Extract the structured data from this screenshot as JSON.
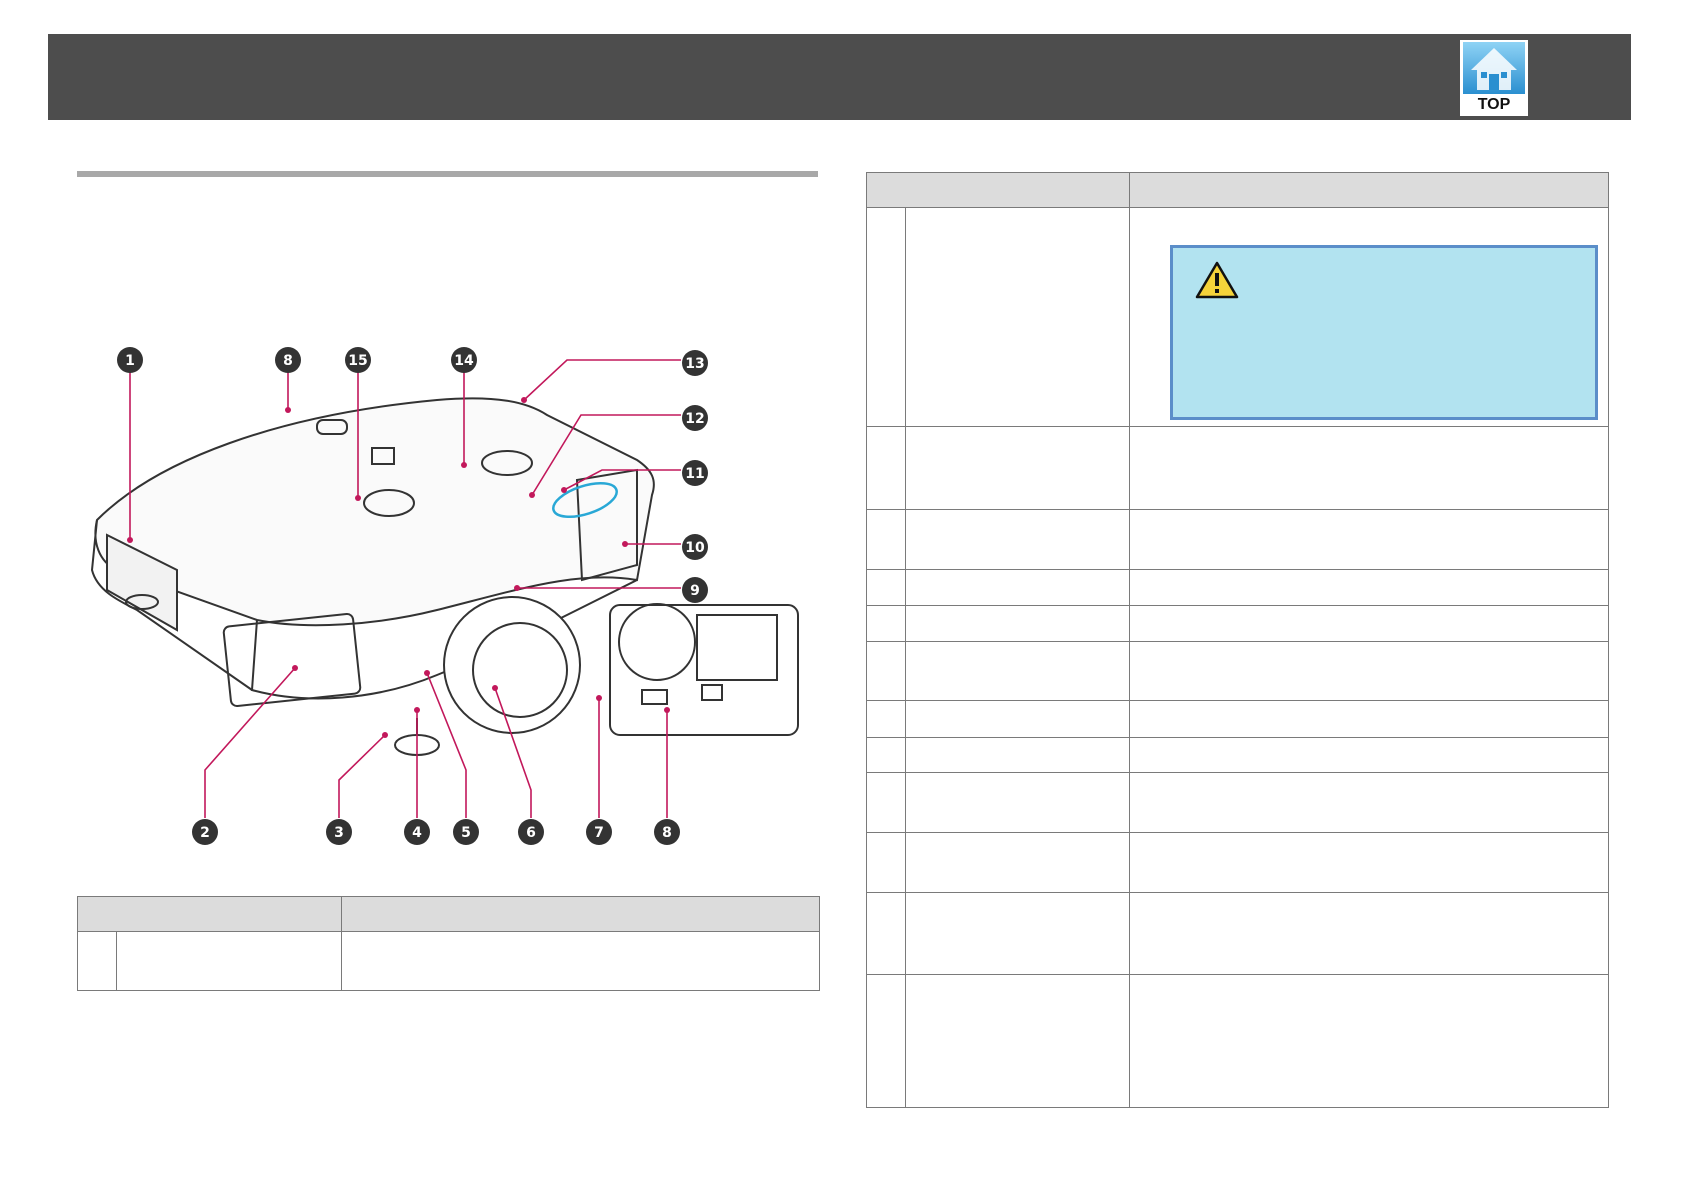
{
  "header": {
    "top_button_label": "TOP"
  },
  "illustration": {
    "callouts": [
      "1",
      "8",
      "15",
      "14",
      "13",
      "12",
      "11",
      "10",
      "9",
      "2",
      "3",
      "4",
      "5",
      "6",
      "7",
      "8"
    ]
  },
  "left_table": {
    "headers": [
      "",
      ""
    ],
    "rows": [
      {
        "num": "",
        "name": "",
        "desc": ""
      }
    ]
  },
  "right_table": {
    "headers": [
      "",
      ""
    ],
    "rows": [
      {
        "num": "",
        "name": "",
        "desc": ""
      },
      {
        "num": "",
        "name": "",
        "desc": ""
      },
      {
        "num": "",
        "name": "",
        "desc": ""
      },
      {
        "num": "",
        "name": "",
        "desc": ""
      },
      {
        "num": "",
        "name": "",
        "desc": ""
      },
      {
        "num": "",
        "name": "",
        "desc": ""
      },
      {
        "num": "",
        "name": "",
        "desc": ""
      },
      {
        "num": "",
        "name": "",
        "desc": ""
      },
      {
        "num": "",
        "name": "",
        "desc": ""
      },
      {
        "num": "",
        "name": "",
        "desc": ""
      },
      {
        "num": "",
        "name": "",
        "desc": ""
      },
      {
        "num": "",
        "name": "",
        "desc": ""
      }
    ]
  },
  "colors": {
    "header_bar": "#4d4d4d",
    "callout_line": "#c2185b",
    "callout_badge": "#333333",
    "caution_fill": "#b2e3f0",
    "caution_border": "#5b8ec9",
    "highlight_ring": "#29a8d6"
  },
  "icons": [
    "home-top-icon",
    "warning-triangle-icon"
  ]
}
